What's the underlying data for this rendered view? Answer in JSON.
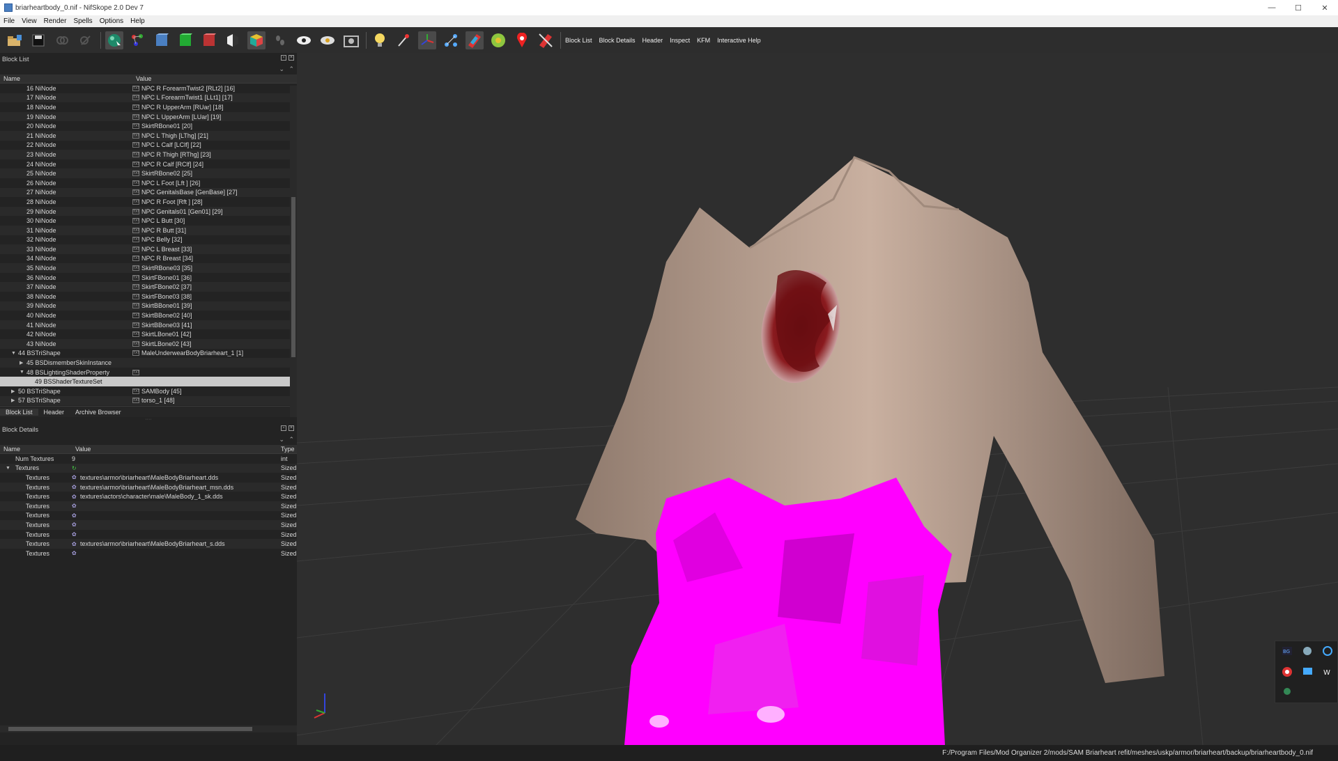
{
  "window": {
    "title": "briarheartbody_0.nif - NifSkope 2.0 Dev 7",
    "minimize": "—",
    "maximize": "☐",
    "close": "✕"
  },
  "menu": [
    "File",
    "View",
    "Render",
    "Spells",
    "Options",
    "Help"
  ],
  "toolbar": {
    "icons": [
      "open-icon",
      "save-icon",
      "link-icon",
      "unlink-icon",
      "select-object-icon",
      "select-vertex-icon",
      "blue-cube-icon",
      "green-cube-icon",
      "red-cube-icon",
      "split-cube-icon",
      "multicolor-cube-icon",
      "footprints-icon",
      "eye-icon",
      "eye-outline-icon",
      "screenshot-icon",
      "light-bulb-icon",
      "wand-icon",
      "axes-icon",
      "nodes-icon",
      "texture-icon",
      "globe-icon",
      "marker-icon",
      "no-texture-icon"
    ],
    "text_buttons": [
      "Block List",
      "Block Details",
      "Header",
      "Inspect",
      "KFM",
      "Interactive Help"
    ]
  },
  "block_list": {
    "title": "Block List",
    "headers": {
      "name": "Name",
      "value": "Value"
    },
    "rows": [
      {
        "name": "16 NiNode",
        "value": "NPC R ForearmTwist2 [RLt2] [16]",
        "indent": 1,
        "icon": "str"
      },
      {
        "name": "17 NiNode",
        "value": "NPC L ForearmTwist1 [LLt1] [17]",
        "indent": 1,
        "icon": "str"
      },
      {
        "name": "18 NiNode",
        "value": "NPC R UpperArm [RUar] [18]",
        "indent": 1,
        "icon": "str"
      },
      {
        "name": "19 NiNode",
        "value": "NPC L UpperArm [LUar] [19]",
        "indent": 1,
        "icon": "str"
      },
      {
        "name": "20 NiNode",
        "value": "SkirtRBone01 [20]",
        "indent": 1,
        "icon": "str"
      },
      {
        "name": "21 NiNode",
        "value": "NPC L Thigh [LThg] [21]",
        "indent": 1,
        "icon": "str"
      },
      {
        "name": "22 NiNode",
        "value": "NPC L Calf [LClf] [22]",
        "indent": 1,
        "icon": "str"
      },
      {
        "name": "23 NiNode",
        "value": "NPC R Thigh [RThg] [23]",
        "indent": 1,
        "icon": "str"
      },
      {
        "name": "24 NiNode",
        "value": "NPC R Calf [RClf] [24]",
        "indent": 1,
        "icon": "str"
      },
      {
        "name": "25 NiNode",
        "value": "SkirtRBone02 [25]",
        "indent": 1,
        "icon": "str"
      },
      {
        "name": "26 NiNode",
        "value": "NPC L Foot [Lft ] [26]",
        "indent": 1,
        "icon": "str"
      },
      {
        "name": "27 NiNode",
        "value": "NPC GenitalsBase [GenBase] [27]",
        "indent": 1,
        "icon": "str"
      },
      {
        "name": "28 NiNode",
        "value": "NPC R Foot [Rft ] [28]",
        "indent": 1,
        "icon": "str"
      },
      {
        "name": "29 NiNode",
        "value": "NPC Genitals01 [Gen01] [29]",
        "indent": 1,
        "icon": "str"
      },
      {
        "name": "30 NiNode",
        "value": "NPC L Butt [30]",
        "indent": 1,
        "icon": "str"
      },
      {
        "name": "31 NiNode",
        "value": "NPC R Butt [31]",
        "indent": 1,
        "icon": "str"
      },
      {
        "name": "32 NiNode",
        "value": "NPC Belly [32]",
        "indent": 1,
        "icon": "str"
      },
      {
        "name": "33 NiNode",
        "value": "NPC L Breast [33]",
        "indent": 1,
        "icon": "str"
      },
      {
        "name": "34 NiNode",
        "value": "NPC R Breast [34]",
        "indent": 1,
        "icon": "str"
      },
      {
        "name": "35 NiNode",
        "value": "SkirtRBone03 [35]",
        "indent": 1,
        "icon": "str"
      },
      {
        "name": "36 NiNode",
        "value": "SkirtFBone01 [36]",
        "indent": 1,
        "icon": "str"
      },
      {
        "name": "37 NiNode",
        "value": "SkirtFBone02 [37]",
        "indent": 1,
        "icon": "str"
      },
      {
        "name": "38 NiNode",
        "value": "SkirtFBone03 [38]",
        "indent": 1,
        "icon": "str"
      },
      {
        "name": "39 NiNode",
        "value": "SkirtBBone01 [39]",
        "indent": 1,
        "icon": "str"
      },
      {
        "name": "40 NiNode",
        "value": "SkirtBBone02 [40]",
        "indent": 1,
        "icon": "str"
      },
      {
        "name": "41 NiNode",
        "value": "SkirtBBone03 [41]",
        "indent": 1,
        "icon": "str"
      },
      {
        "name": "42 NiNode",
        "value": "SkirtLBone01 [42]",
        "indent": 1,
        "icon": "str"
      },
      {
        "name": "43 NiNode",
        "value": "SkirtLBone02 [43]",
        "indent": 1,
        "icon": "str"
      },
      {
        "name": "44 BSTriShape",
        "value": "MaleUnderwearBodyBriarheart_1 [1]",
        "indent": 0,
        "icon": "str",
        "toggle": "expanded"
      },
      {
        "name": "45 BSDismemberSkinInstance",
        "value": "",
        "indent": 1,
        "icon": "",
        "toggle": "collapsed"
      },
      {
        "name": "48 BSLightingShaderProperty",
        "value": "",
        "indent": 1,
        "icon": "str",
        "toggle": "expanded"
      },
      {
        "name": "49 BSShaderTextureSet",
        "value": "",
        "indent": 2,
        "icon": "",
        "selected": true
      },
      {
        "name": "50 BSTriShape",
        "value": "SAMBody [45]",
        "indent": 0,
        "icon": "str",
        "toggle": "collapsed"
      },
      {
        "name": "57 BSTriShape",
        "value": "torso_1 [48]",
        "indent": 0,
        "icon": "str",
        "toggle": "collapsed"
      }
    ],
    "tabs": [
      "Block List",
      "Header",
      "Archive Browser"
    ]
  },
  "block_details": {
    "title": "Block Details",
    "headers": {
      "name": "Name",
      "value": "Value",
      "type": "Type"
    },
    "rows": [
      {
        "name": "Num Textures",
        "value": "9",
        "type": "int",
        "indent": 1,
        "icon": ""
      },
      {
        "name": "Textures",
        "value": "",
        "type": "Sized",
        "indent": 0,
        "icon": "array",
        "toggle": "expanded"
      },
      {
        "name": "Textures",
        "value": "textures\\armor\\briarheart\\MaleBodyBriarheart.dds",
        "type": "Sized",
        "indent": 2,
        "icon": "geo"
      },
      {
        "name": "Textures",
        "value": "textures\\armor\\briarheart\\MaleBodyBriarheart_msn.dds",
        "type": "Sized",
        "indent": 2,
        "icon": "geo"
      },
      {
        "name": "Textures",
        "value": "textures\\actors\\character\\male\\MaleBody_1_sk.dds",
        "type": "Sized",
        "indent": 2,
        "icon": "geo"
      },
      {
        "name": "Textures",
        "value": "",
        "type": "Sized",
        "indent": 2,
        "icon": "geo"
      },
      {
        "name": "Textures",
        "value": "",
        "type": "Sized",
        "indent": 2,
        "icon": "geo"
      },
      {
        "name": "Textures",
        "value": "",
        "type": "Sized",
        "indent": 2,
        "icon": "geo"
      },
      {
        "name": "Textures",
        "value": "",
        "type": "Sized",
        "indent": 2,
        "icon": "geo"
      },
      {
        "name": "Textures",
        "value": "textures\\armor\\briarheart\\MaleBodyBriarheart_s.dds",
        "type": "Sized",
        "indent": 2,
        "icon": "geo"
      },
      {
        "name": "Textures",
        "value": "",
        "type": "Sized",
        "indent": 2,
        "icon": "geo"
      }
    ]
  },
  "status_bar": {
    "path": "F:/Program Files/Mod Organizer 2/mods/SAM Briarheart refit/meshes/uskp/armor/briarheart/backup/briarheartbody_0.nif"
  },
  "colors": {
    "skin": "#b8a090",
    "wound": "#7a1515",
    "missing_texture": "#ff00ff",
    "background": "#2e2e2e",
    "selection": "#c9c9c9"
  },
  "tray": {
    "icons": [
      "bg-icon",
      "steam-icon",
      "refresh-icon",
      "chrome-icon",
      "monitor-icon",
      "ww-icon",
      "leaf-icon"
    ]
  }
}
